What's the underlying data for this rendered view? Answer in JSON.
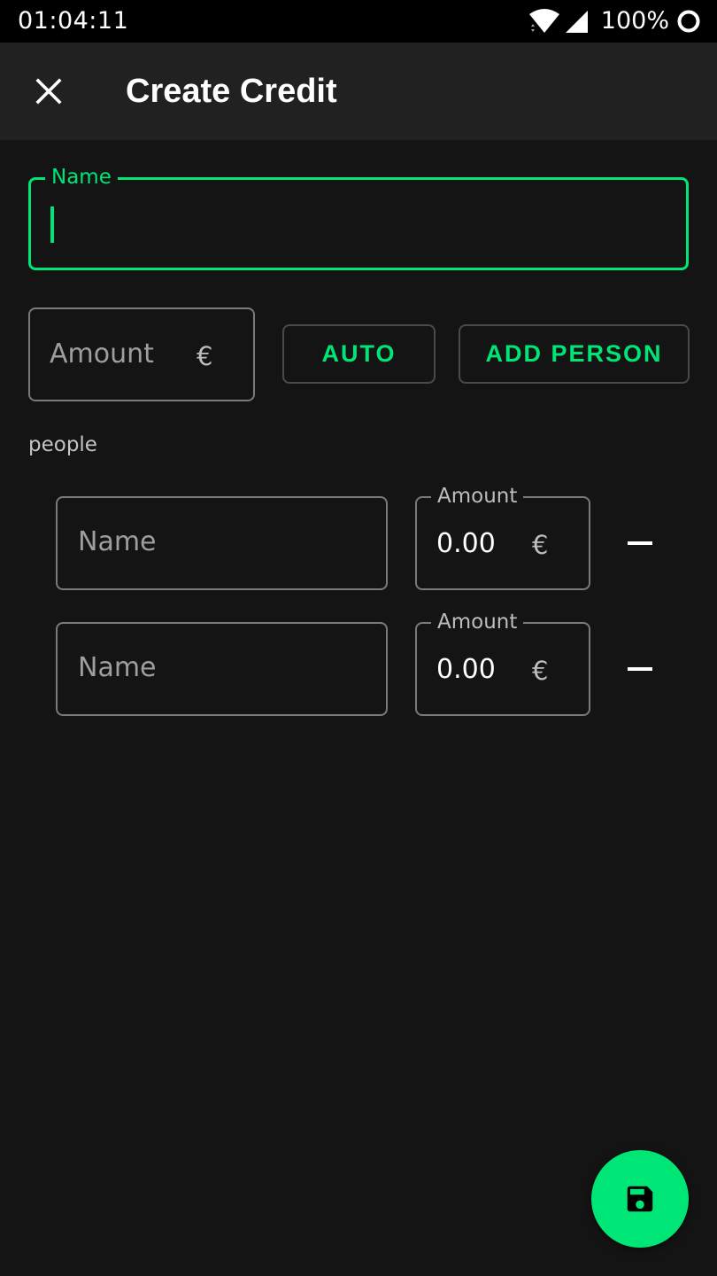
{
  "status_bar": {
    "time": "01:04:11",
    "battery_percent": "100%",
    "icons": [
      "wifi-icon",
      "signal-icon",
      "battery-icon"
    ]
  },
  "app_bar": {
    "close_icon": "close-icon",
    "title": "Create Credit"
  },
  "form": {
    "name_field": {
      "label": "Name",
      "value": "",
      "focused": true
    },
    "amount_field": {
      "placeholder": "Amount",
      "currency": "€"
    },
    "auto_button": "AUTO",
    "add_person_button": "ADD PERSON",
    "people_label": "people",
    "people": [
      {
        "name_placeholder": "Name",
        "amount_label": "Amount",
        "amount_value": "0.00",
        "currency": "€",
        "remove_icon": "minus-icon"
      },
      {
        "name_placeholder": "Name",
        "amount_label": "Amount",
        "amount_value": "0.00",
        "currency": "€",
        "remove_icon": "minus-icon"
      }
    ]
  },
  "fab": {
    "icon": "save-icon"
  },
  "colors": {
    "accent": "#00e676",
    "background": "#141414",
    "app_bar": "#212121",
    "status_bar": "#000000"
  }
}
